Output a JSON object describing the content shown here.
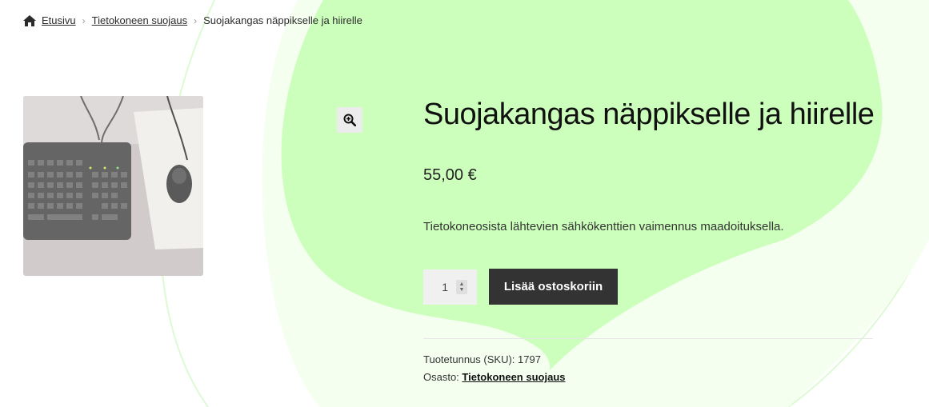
{
  "breadcrumb": {
    "home_icon": "home-icon",
    "items": [
      "Etusivu",
      "Tietokoneen suojaus"
    ],
    "current": "Suojakangas näppikselle ja hiirelle",
    "separator": "›"
  },
  "gallery": {
    "zoom_icon": "magnifier-plus-icon"
  },
  "product": {
    "title": "Suojakangas näppikselle ja hiirelle",
    "price": "55,00 €",
    "description": "Tietokoneosista lähtevien sähkökenttien vaimennus maadoituksella.",
    "quantity": "1",
    "add_to_cart_label": "Lisää ostoskoriin",
    "sku_label": "Tuotetunnus (SKU):",
    "sku_value": "1797",
    "category_label": "Osasto:",
    "category_value": "Tietokoneen suojaus"
  },
  "colors": {
    "background_blob": "#ccffbb",
    "button": "#333333"
  }
}
